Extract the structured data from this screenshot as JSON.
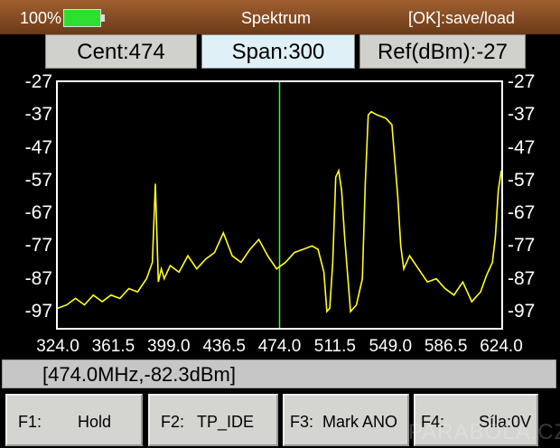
{
  "status_bar": {
    "battery_percent": "100%",
    "battery_level": 1.0,
    "title": "Spektrum",
    "ok_hint": "[OK]:save/load"
  },
  "params": {
    "center": "Cent:474",
    "span": "Span:300",
    "ref": "Ref(dBm):-27"
  },
  "readout": "[474.0MHz,-82.3dBm]",
  "function_keys": [
    {
      "key": "F1:",
      "label": "Hold"
    },
    {
      "key": "F2:",
      "label": "TP_IDE"
    },
    {
      "key": "F3:",
      "label": "Mark ANO"
    },
    {
      "key": "F4:",
      "label": "Síla:0V"
    }
  ],
  "watermark": "PARABOLA.CZ",
  "colors": {
    "trace": "#ffff20",
    "marker": "#30ff30",
    "battery": "#2ee02e"
  },
  "chart_data": {
    "type": "line",
    "y_ticks": [
      "-27",
      "-37",
      "-47",
      "-57",
      "-67",
      "-77",
      "-87",
      "-97"
    ],
    "x_ticks": [
      "324.0",
      "361.5",
      "399.0",
      "436.5",
      "474.0",
      "511.5",
      "549.0",
      "586.5",
      "624.0"
    ],
    "xlim": [
      324,
      624
    ],
    "ylim": [
      -102,
      -27
    ],
    "marker_x": 474.0,
    "series": [
      {
        "x": [
          324,
          330,
          336,
          342,
          348,
          354,
          360,
          366,
          372,
          378,
          384,
          388,
          390,
          392,
          394,
          396,
          400,
          406,
          412,
          418,
          424,
          430,
          436,
          442,
          448,
          454,
          460,
          466,
          472,
          478,
          484,
          490,
          496,
          500,
          504,
          506,
          508,
          510,
          512,
          514,
          516,
          518,
          522,
          526,
          530,
          532,
          534,
          536,
          540,
          546,
          550,
          554,
          556,
          558,
          562,
          568,
          574,
          580,
          586,
          592,
          598,
          604,
          610,
          614,
          618,
          620,
          622,
          624
        ],
        "y": [
          -96,
          -95,
          -93,
          -95,
          -92,
          -94,
          -92,
          -93,
          -90,
          -91,
          -87,
          -82,
          -58,
          -88,
          -84,
          -87,
          -83,
          -85,
          -80,
          -84,
          -81,
          -79,
          -73,
          -80,
          -82,
          -78,
          -75,
          -80,
          -84,
          -82,
          -79,
          -78,
          -77,
          -78,
          -85,
          -97,
          -96,
          -82,
          -56,
          -54,
          -60,
          -74,
          -97,
          -95,
          -87,
          -58,
          -37,
          -36,
          -37,
          -38,
          -40,
          -62,
          -77,
          -84,
          -80,
          -84,
          -88,
          -87,
          -90,
          -92,
          -88,
          -94,
          -91,
          -86,
          -82,
          -74,
          -60,
          -54
        ]
      }
    ]
  }
}
